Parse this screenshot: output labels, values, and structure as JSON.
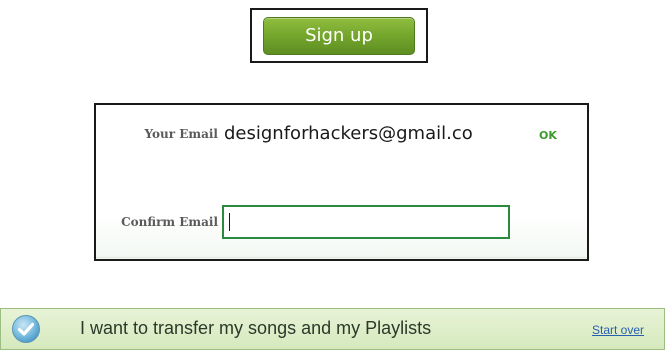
{
  "signup": {
    "button_label": "Sign up"
  },
  "email_form": {
    "email_label": "Your Email",
    "email_value": "designforhackers@gmail.co",
    "ok_label": "OK",
    "confirm_label": "Confirm Email",
    "confirm_value": "",
    "input_border_color": "#2c8a3e"
  },
  "transfer_bar": {
    "icon": "checkmark-circle-icon",
    "message": "I want to transfer my songs and my Playlists",
    "start_over_label": "Start over",
    "background_color": "#d5e9bd"
  }
}
